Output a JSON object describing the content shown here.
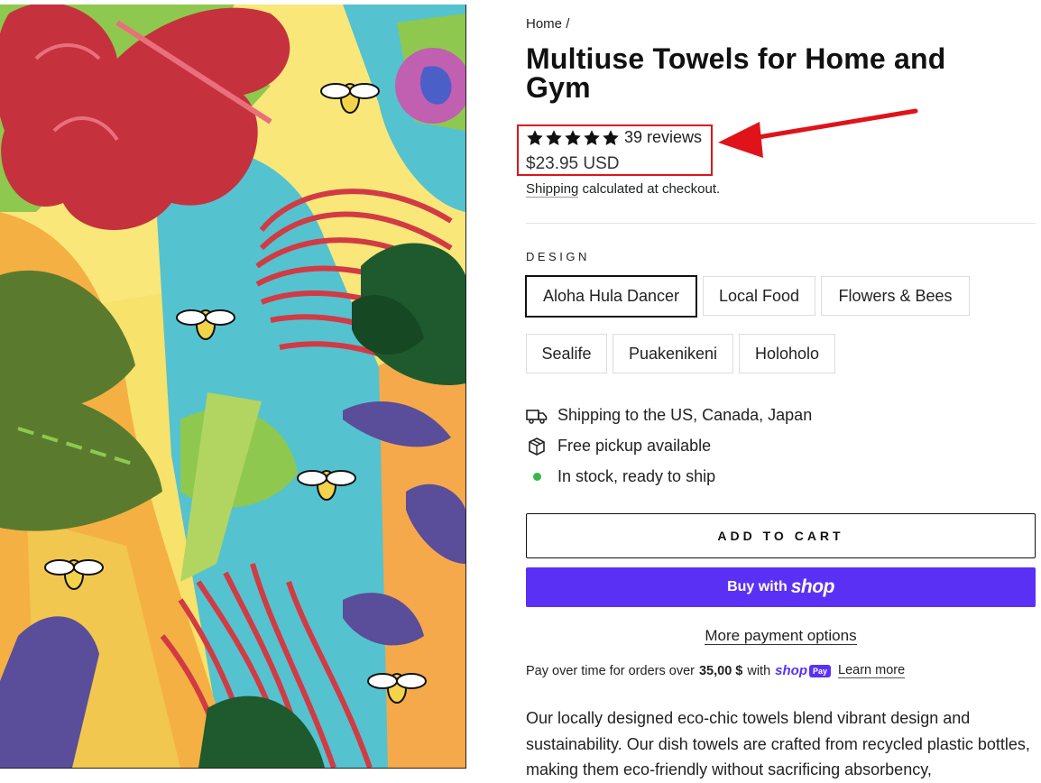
{
  "breadcrumb": {
    "home": "Home",
    "sep": "/"
  },
  "product": {
    "title": "Multiuse Towels for Home and Gym",
    "rating": 5,
    "reviews": "39 reviews",
    "price": "$23.95 USD"
  },
  "shipping_note": {
    "link": "Shipping",
    "text": " calculated at checkout."
  },
  "design": {
    "label": "DESIGN",
    "options": [
      "Aloha Hula Dancer",
      "Local Food",
      "Flowers & Bees",
      "Sealife",
      "Puakenikeni",
      "Holoholo"
    ],
    "selected": "Aloha Hula Dancer"
  },
  "features": [
    {
      "icon": "truck-icon",
      "text": "Shipping to the US, Canada, Japan"
    },
    {
      "icon": "box-icon",
      "text": "Free pickup available"
    },
    {
      "icon": "in-stock-dot-icon",
      "text": "In stock, ready to ship"
    }
  ],
  "buttons": {
    "add_to_cart": "ADD TO CART",
    "buy_with": "Buy with",
    "shop": "shop",
    "more_payment": "More payment options"
  },
  "installments": {
    "text": "Pay over time for orders over",
    "amount": "35,00 $",
    "with": "with",
    "shop": "shop",
    "pay": "Pay",
    "learn_more": "Learn more"
  },
  "description": "Our locally designed eco-chic towels blend vibrant design and sustainability. Our dish towels are crafted from recycled plastic bottles, making them eco-friendly without sacrificing absorbency,",
  "colors": {
    "accent": "#5a31f4",
    "highlight": "#e0131b",
    "stock": "#3bb54a"
  }
}
